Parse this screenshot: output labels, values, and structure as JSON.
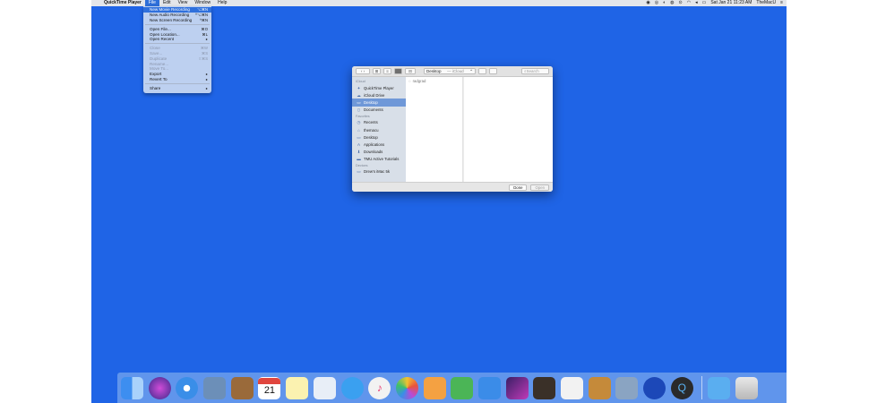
{
  "menubar": {
    "app_name": "QuickTime Player",
    "menus": [
      "File",
      "Edit",
      "View",
      "Window",
      "Help"
    ],
    "clock": "Sat Jan 21  11:23 AM",
    "user": "TheMacU"
  },
  "file_menu": {
    "items": [
      {
        "label": "New Movie Recording",
        "shortcut": "⌥⌘N",
        "state": "highlighted"
      },
      {
        "label": "New Audio Recording",
        "shortcut": "^⌥⌘N",
        "state": "enabled"
      },
      {
        "label": "New Screen Recording",
        "shortcut": "^⌘N",
        "state": "enabled"
      },
      {
        "label": "Open File...",
        "shortcut": "⌘O",
        "state": "enabled"
      },
      {
        "label": "Open Location...",
        "shortcut": "⌘L",
        "state": "enabled"
      },
      {
        "label": "Open Recent",
        "shortcut": "▸",
        "state": "enabled"
      },
      {
        "label": "Close",
        "shortcut": "⌘W",
        "state": "disabled"
      },
      {
        "label": "Save...",
        "shortcut": "⌘S",
        "state": "disabled"
      },
      {
        "label": "Duplicate",
        "shortcut": "⇧⌘S",
        "state": "disabled"
      },
      {
        "label": "Rename...",
        "shortcut": "",
        "state": "disabled"
      },
      {
        "label": "Move To...",
        "shortcut": "",
        "state": "disabled"
      },
      {
        "label": "Export",
        "shortcut": "▸",
        "state": "enabled"
      },
      {
        "label": "Revert To",
        "shortcut": "▸",
        "state": "enabled"
      },
      {
        "label": "Share",
        "shortcut": "▸",
        "state": "enabled"
      }
    ]
  },
  "dialog": {
    "location": "Desktop",
    "location_sub": "— iCloud",
    "search_placeholder": "Search",
    "sidebar": {
      "section_icloud": "iCloud",
      "section_favorites": "Favorites",
      "section_devices": "Devices",
      "icloud_items": [
        "QuickTime Player",
        "iCloud Drive",
        "Desktop",
        "Documents"
      ],
      "favorites_items": [
        "Recents",
        "themacu",
        "Desktop",
        "Applications",
        "Downloads",
        "TMU Active Tutorials"
      ],
      "devices_items": [
        "Drew's iMac 5k"
      ]
    },
    "file": "radgrad",
    "done_label": "Done",
    "open_label": "Open"
  },
  "dock": {
    "calendar_day": "21",
    "icons": [
      "finder-icon",
      "siri-icon",
      "safari-icon",
      "preview-icon",
      "contacts-icon",
      "calendar-icon",
      "notes-icon",
      "reminders-icon",
      "messages-icon",
      "itunes-icon",
      "photos-icon",
      "pages-icon",
      "numbers-icon",
      "keynote-icon",
      "affinity-icon",
      "garageband-icon",
      "textedit-icon",
      "pixelmator-icon",
      "image-capture-icon",
      "photo-booth-icon",
      "quicktime-icon",
      "downloads-icon",
      "trash-icon"
    ]
  }
}
